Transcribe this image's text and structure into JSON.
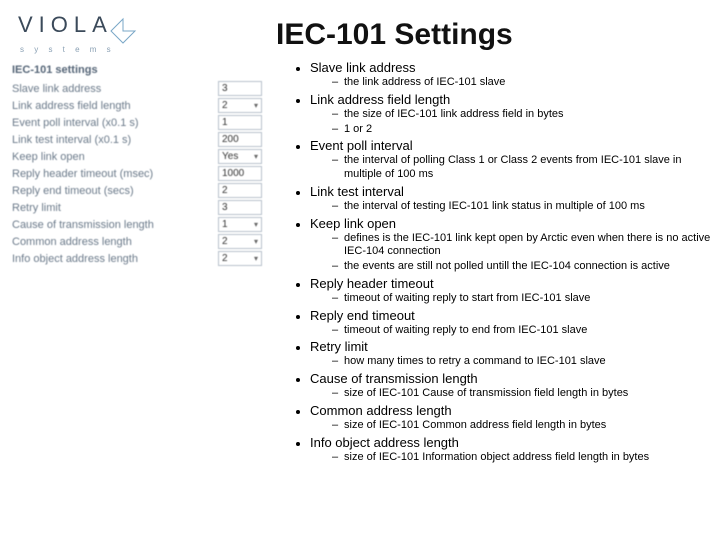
{
  "logo": {
    "brand": "VIOLA",
    "sub": "s y s t e m s"
  },
  "title": "IEC-101 Settings",
  "panel": {
    "header": "IEC-101 settings",
    "rows": [
      {
        "label": "Slave link address",
        "value": "3",
        "kind": "text"
      },
      {
        "label": "Link address field length",
        "value": "2",
        "kind": "select"
      },
      {
        "label": "Event poll interval (x0.1 s)",
        "value": "1",
        "kind": "text"
      },
      {
        "label": "Link test interval (x0.1 s)",
        "value": "200",
        "kind": "text"
      },
      {
        "label": "Keep link open",
        "value": "Yes",
        "kind": "select"
      },
      {
        "label": "Reply header timeout (msec)",
        "value": "1000",
        "kind": "text"
      },
      {
        "label": "Reply end timeout (secs)",
        "value": "2",
        "kind": "text"
      },
      {
        "label": "Retry limit",
        "value": "3",
        "kind": "text"
      },
      {
        "label": "Cause of transmission length",
        "value": "1",
        "kind": "select"
      },
      {
        "label": "Common address length",
        "value": "2",
        "kind": "select"
      },
      {
        "label": "Info object address length",
        "value": "2",
        "kind": "select"
      }
    ]
  },
  "items": [
    {
      "title": "Slave link address",
      "subs": [
        "the link address of IEC-101 slave"
      ]
    },
    {
      "title": "Link address field length",
      "subs": [
        "the size of IEC-101 link address field in bytes",
        "1 or 2"
      ]
    },
    {
      "title": "Event poll interval",
      "subs": [
        "the interval of polling Class 1 or Class 2 events from IEC-101 slave in multiple of 100 ms"
      ]
    },
    {
      "title": "Link test interval",
      "subs": [
        "the interval of testing IEC-101 link status in multiple of 100 ms"
      ]
    },
    {
      "title": "Keep link open",
      "subs": [
        "defines is the IEC-101 link kept open by Arctic even when there is no active IEC-104 connection",
        "the events are still not polled untill the IEC-104 connection is active"
      ]
    },
    {
      "title": "Reply header timeout",
      "subs": [
        "timeout of waiting reply to start from IEC-101 slave"
      ]
    },
    {
      "title": "Reply end timeout",
      "subs": [
        "timeout of waiting reply to end from IEC-101 slave"
      ]
    },
    {
      "title": "Retry limit",
      "subs": [
        "how many times to retry a command to IEC-101 slave"
      ]
    },
    {
      "title": "Cause of transmission length",
      "subs": [
        "size of IEC-101 Cause of transmission field length in bytes"
      ]
    },
    {
      "title": "Common address length",
      "subs": [
        "size of IEC-101 Common address field length in bytes"
      ]
    },
    {
      "title": "Info object address length",
      "subs": [
        "size of IEC-101 Information object address field length in bytes"
      ]
    }
  ]
}
